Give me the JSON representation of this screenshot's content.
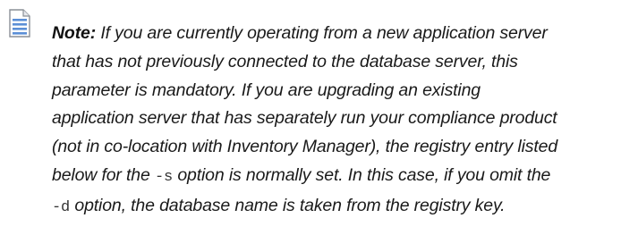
{
  "note": {
    "icon": "note-document-icon",
    "icon_color": "#5b8fd6",
    "label": "Note:",
    "line1_rest": " If you are currently operating from a new application server",
    "line2": "that has not previously connected to the database server, this",
    "line3": "parameter is mandatory. If you are upgrading an existing",
    "line4": "application server that has separately run your compliance product",
    "line5": "(not in co-location with Inventory Manager), the registry entry listed",
    "line6_before": "below for the ",
    "option_s": "-s",
    "line6_after": " option is normally set. In this case, if you omit the",
    "option_d": "-d",
    "line7_after": " option, the database name is taken from the registry key."
  }
}
